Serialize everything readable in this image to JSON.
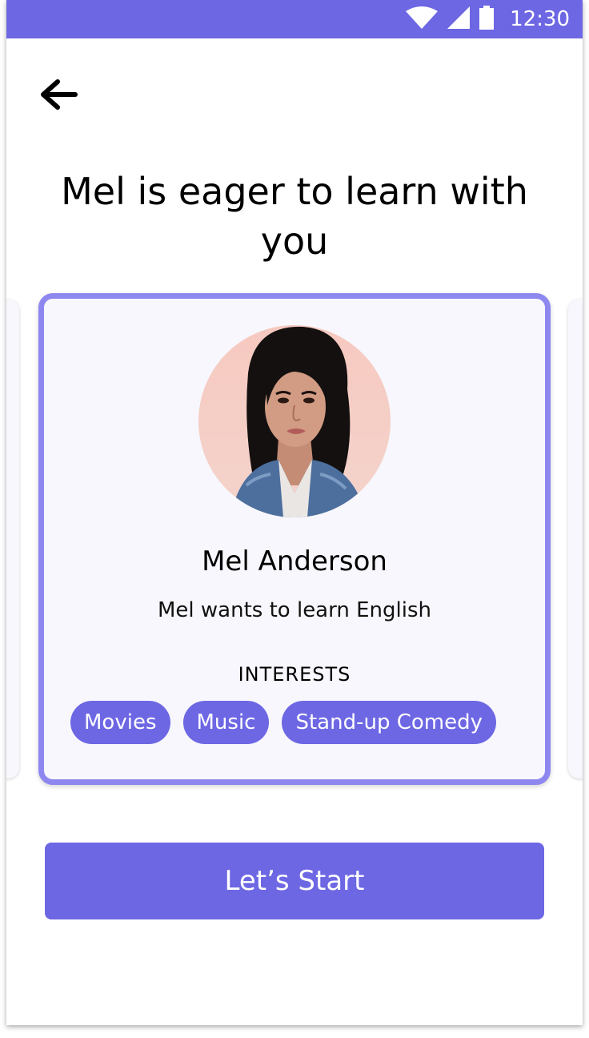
{
  "status_bar": {
    "time": "12:30",
    "icons": [
      "wifi-icon",
      "signal-icon",
      "battery-icon"
    ],
    "background_color": "#6d67e4"
  },
  "header": {
    "back_icon": "arrow-left-icon",
    "title": "Mel is eager to learn with you"
  },
  "profile_card": {
    "name": "Mel Anderson",
    "subtitle": "Mel wants to learn English",
    "interests_heading": "INTERESTS",
    "interests": [
      "Movies",
      "Music",
      "Stand-up Comedy"
    ],
    "border_color": "#8f87f0",
    "background_color": "#f7f7fd"
  },
  "actions": {
    "start_label": "Let’s Start",
    "button_color": "#6d67e4"
  }
}
